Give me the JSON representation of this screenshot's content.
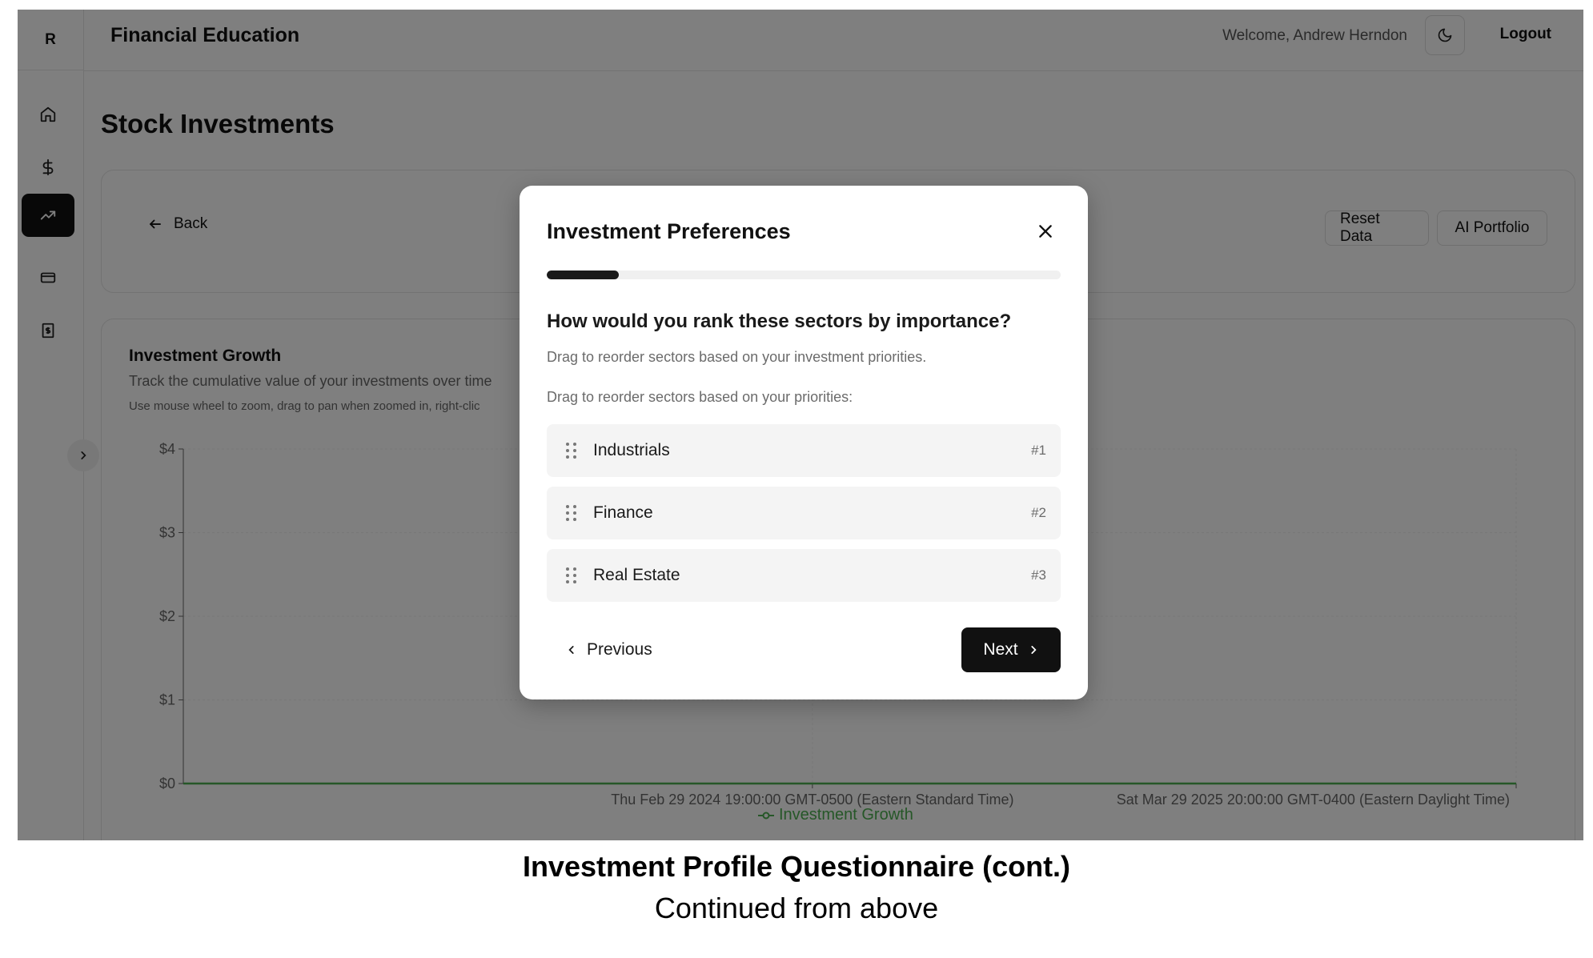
{
  "app": {
    "logo_letter": "R",
    "title": "Financial Education",
    "welcome": "Welcome, Andrew Herndon",
    "logout_label": "Logout"
  },
  "sidebar": {
    "items": [
      {
        "icon": "home-icon",
        "label": "Home"
      },
      {
        "icon": "dollar-icon",
        "label": "Finance"
      },
      {
        "icon": "trending-up-icon",
        "label": "Stock Investments",
        "active": true
      },
      {
        "icon": "credit-card-icon",
        "label": "Cards"
      },
      {
        "icon": "receipt-icon",
        "label": "Bills"
      }
    ]
  },
  "main": {
    "page_title": "Stock Investments",
    "back_label": "Back",
    "reset_label": "Reset Data",
    "ai_label": "AI Portfolio"
  },
  "chart": {
    "title": "Investment Growth",
    "description": "Track the cumulative value of your investments over time",
    "hint": "Use mouse wheel to zoom, drag to pan when zoomed in, right-clic",
    "legend": "Investment Growth"
  },
  "chart_data": {
    "type": "line",
    "title": "Investment Growth",
    "y_tick_labels": [
      "$0",
      "$1",
      "$2",
      "$3",
      "$4"
    ],
    "x_tick_labels": [
      "Thu Feb 29 2024 19:00:00 GMT-0500 (Eastern Standard Time)",
      "Sat Mar 29 2025 20:00:00 GMT-0400 (Eastern Daylight Time)"
    ],
    "ylim": [
      0,
      4
    ],
    "series": [
      {
        "name": "Investment Growth",
        "color": "#4caf50",
        "x": [
          "Thu Feb 29 2024 19:00:00 GMT-0500 (Eastern Standard Time)",
          "Sat Mar 29 2025 20:00:00 GMT-0400 (Eastern Daylight Time)"
        ],
        "values": [
          0,
          0
        ]
      }
    ],
    "grid": true,
    "legend_position": "bottom"
  },
  "modal": {
    "title": "Investment Preferences",
    "progress": 0.14,
    "question": "How would you rank these sectors by importance?",
    "question_sub": "Drag to reorder sectors based on your investment priorities.",
    "list_label": "Drag to reorder sectors based on your priorities:",
    "sectors": [
      {
        "name": "Industrials",
        "rank": "#1"
      },
      {
        "name": "Finance",
        "rank": "#2"
      },
      {
        "name": "Real Estate",
        "rank": "#3"
      }
    ],
    "previous_label": "Previous",
    "next_label": "Next"
  },
  "caption": {
    "title": "Investment Profile Questionnaire (cont.)",
    "subtitle": "Continued from above"
  },
  "colors": {
    "accent": "#111111",
    "chart_line": "#4caf50"
  }
}
